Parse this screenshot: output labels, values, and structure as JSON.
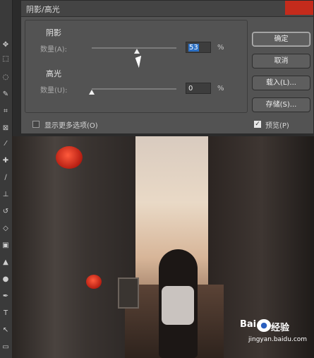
{
  "dialog": {
    "title": "阴影/高光",
    "shadows": {
      "section_label": "阴影",
      "amount_label": "数量(A):",
      "amount_value": "53",
      "unit": "%",
      "slider_fraction": 0.53
    },
    "highlights": {
      "section_label": "高光",
      "amount_label": "数量(U):",
      "amount_value": "0",
      "unit": "%",
      "slider_fraction": 0.0
    },
    "more_options_label": "显示更多选项(O)",
    "more_options_checked": false,
    "preview_label": "预览(P)",
    "preview_checked": true,
    "buttons": {
      "ok": "确定",
      "cancel": "取消",
      "load": "载入(L)...",
      "save": "存储(S)..."
    }
  },
  "toolbar": {
    "icons": [
      "move-icon",
      "marquee-icon",
      "lasso-icon",
      "quick-select-icon",
      "crop-icon",
      "frame-icon",
      "eyedropper-icon",
      "healing-icon",
      "brush-icon",
      "stamp-icon",
      "history-brush-icon",
      "eraser-icon",
      "gradient-icon",
      "blur-icon",
      "dodge-icon",
      "pen-icon",
      "type-icon",
      "path-select-icon",
      "shape-icon"
    ]
  },
  "watermark": {
    "brand_a": "Bai",
    "brand_b": "经验",
    "url": "jingyan.baidu.com"
  },
  "colors": {
    "dialog_bg": "#535353",
    "close_red": "#c42b1c",
    "selection_blue": "#2b6fc4"
  }
}
